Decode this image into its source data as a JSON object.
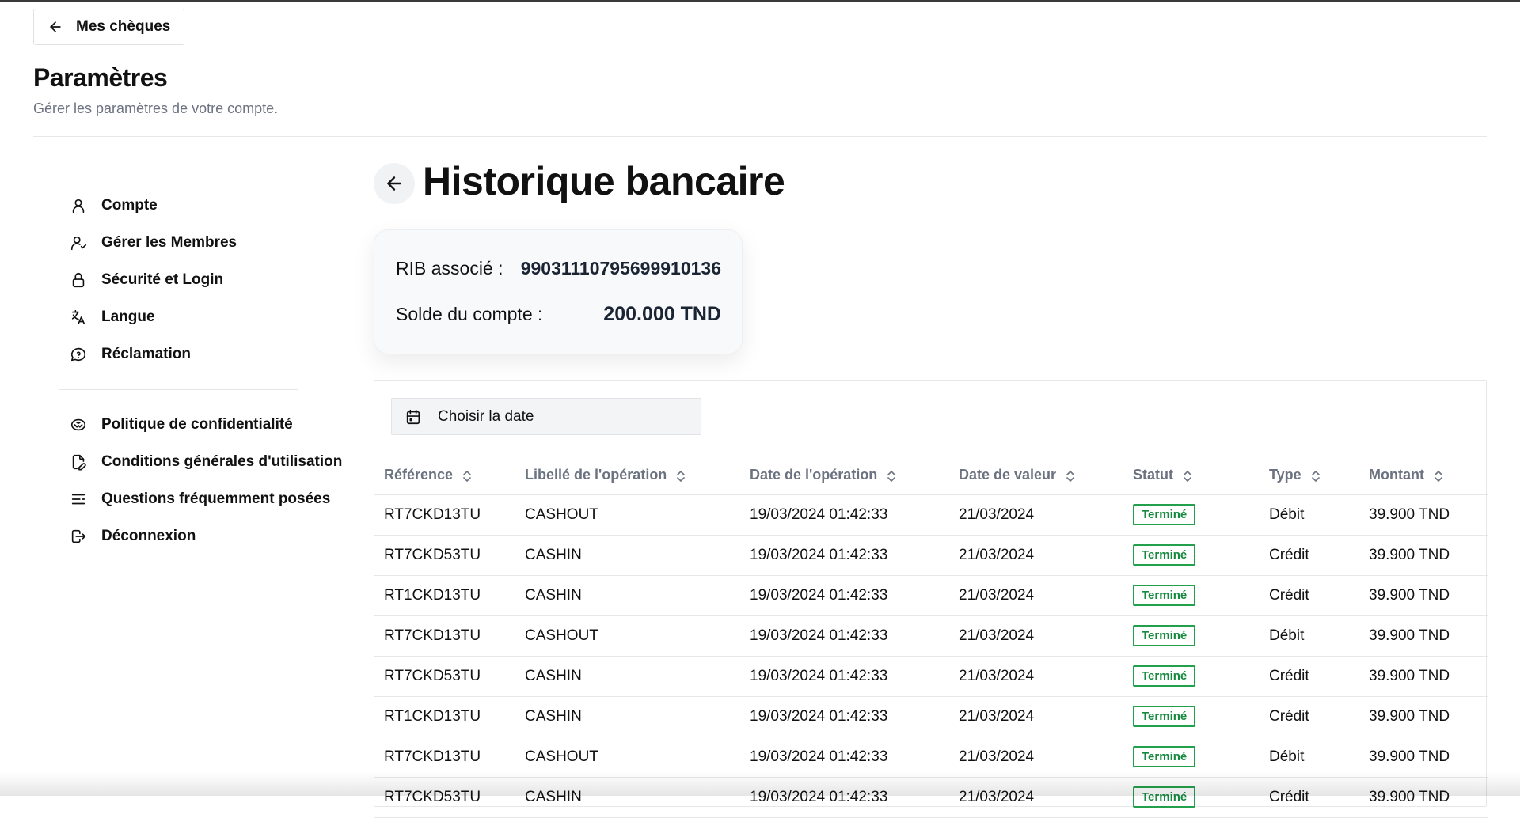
{
  "header": {
    "back_label": "Mes chèques",
    "title": "Paramètres",
    "subtitle": "Gérer les paramètres de votre compte."
  },
  "sidebar": {
    "items": [
      {
        "label": "Compte",
        "icon": "user-icon"
      },
      {
        "label": "Gérer les Membres",
        "icon": "user-check-icon"
      },
      {
        "label": "Sécurité et Login",
        "icon": "lock-icon"
      },
      {
        "label": "Langue",
        "icon": "translate-icon"
      },
      {
        "label": "Réclamation",
        "icon": "message-help-icon"
      }
    ],
    "secondary_items": [
      {
        "label": "Politique de confidentialité",
        "icon": "handshake-icon"
      },
      {
        "label": "Conditions générales d'utilisation",
        "icon": "file-edit-icon"
      },
      {
        "label": "Questions fréquemment posées",
        "icon": "list-icon"
      },
      {
        "label": "Déconnexion",
        "icon": "logout-icon"
      }
    ]
  },
  "main": {
    "title": "Historique bancaire",
    "account": {
      "rib_label": "RIB associé :",
      "rib_value": "99031110795699910136",
      "balance_label": "Solde du compte :",
      "balance_value": "200.000 TND"
    },
    "date_picker_label": "Choisir la date",
    "table": {
      "columns": [
        "Référence",
        "Libellé de l'opération",
        "Date de l'opération",
        "Date de valeur",
        "Statut",
        "Type",
        "Montant"
      ],
      "rows": [
        [
          "RT7CKD13TU",
          "CASHOUT",
          "19/03/2024 01:42:33",
          "21/03/2024",
          "Terminé",
          "Débit",
          "39.900 TND"
        ],
        [
          "RT7CKD53TU",
          "CASHIN",
          "19/03/2024 01:42:33",
          "21/03/2024",
          "Terminé",
          "Crédit",
          "39.900 TND"
        ],
        [
          "RT1CKD13TU",
          "CASHIN",
          "19/03/2024 01:42:33",
          "21/03/2024",
          "Terminé",
          "Crédit",
          "39.900 TND"
        ],
        [
          "RT7CKD13TU",
          "CASHOUT",
          "19/03/2024 01:42:33",
          "21/03/2024",
          "Terminé",
          "Débit",
          "39.900 TND"
        ],
        [
          "RT7CKD53TU",
          "CASHIN",
          "19/03/2024 01:42:33",
          "21/03/2024",
          "Terminé",
          "Crédit",
          "39.900 TND"
        ],
        [
          "RT1CKD13TU",
          "CASHIN",
          "19/03/2024 01:42:33",
          "21/03/2024",
          "Terminé",
          "Crédit",
          "39.900 TND"
        ],
        [
          "RT7CKD13TU",
          "CASHOUT",
          "19/03/2024 01:42:33",
          "21/03/2024",
          "Terminé",
          "Débit",
          "39.900 TND"
        ],
        [
          "RT7CKD53TU",
          "CASHIN",
          "19/03/2024 01:42:33",
          "21/03/2024",
          "Terminé",
          "Crédit",
          "39.900 TND"
        ]
      ]
    }
  },
  "colors": {
    "status_green": "#22a04b",
    "muted_text": "#6b7280",
    "border": "#e5e7eb"
  }
}
